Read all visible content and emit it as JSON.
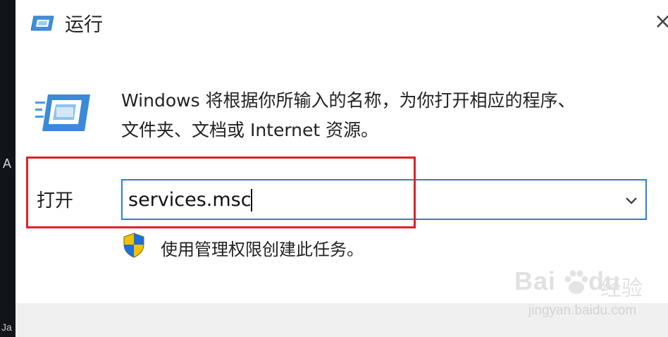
{
  "window": {
    "title": "运行",
    "close_glyph": "×"
  },
  "description": {
    "line1": "Windows 将根据你所输入的名称，为你打开相应的程序、",
    "line2": "文件夹、文档或 Internet 资源。"
  },
  "open_field": {
    "label": "打开",
    "value": "services.msc"
  },
  "admin_note": "使用管理权限创建此任务。",
  "desktop_glyphs": {
    "left_a": "A",
    "left_ja": "Ja"
  },
  "watermark": {
    "brand": "Bai",
    "brand_tail": "du",
    "product": "经验",
    "url": "jingyan.baidu.com"
  },
  "colors": {
    "accent_border": "#2d7fd8",
    "highlight": "#e0202a",
    "footer_bg": "#f0f0f0"
  },
  "icons": [
    "run-icon",
    "run-large-icon",
    "close-icon",
    "chevron-down-icon",
    "shield-icon",
    "baidu-paw-icon"
  ]
}
